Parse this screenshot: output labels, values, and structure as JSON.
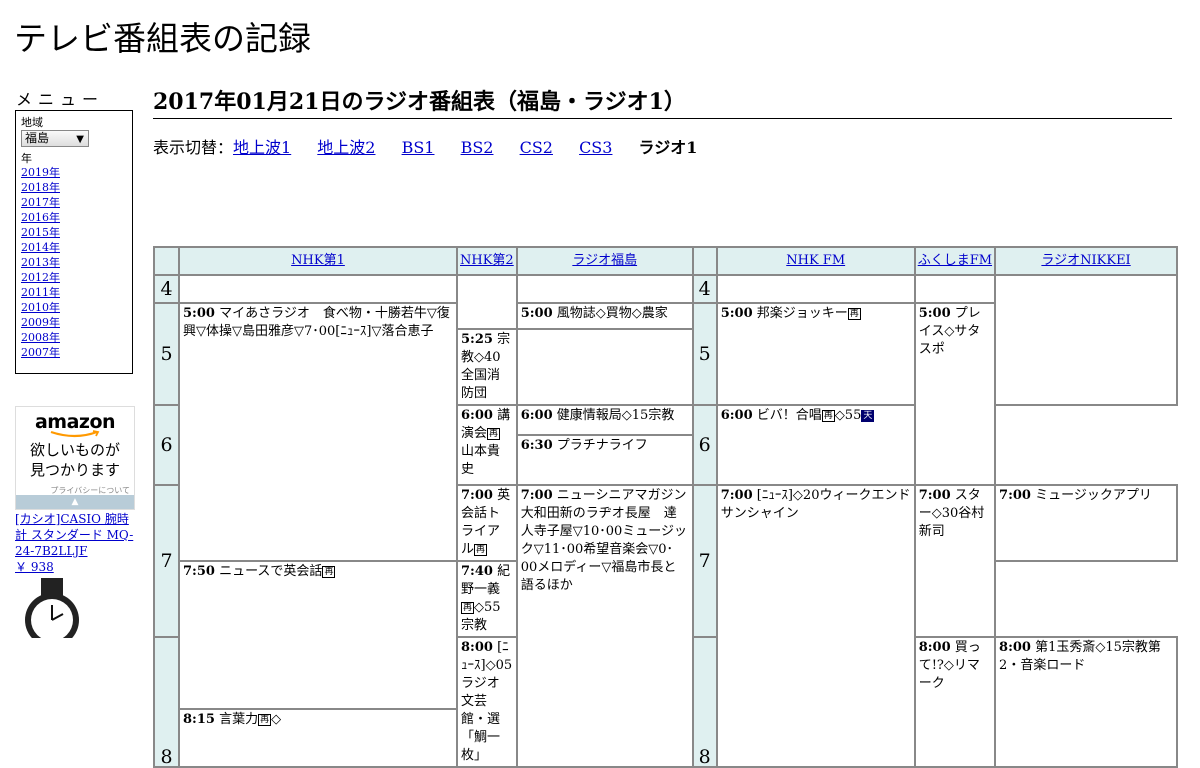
{
  "site": {
    "title": "テレビ番組表の記録"
  },
  "menu": {
    "label": "メニュー",
    "region_label": "地域",
    "region_value": "福島",
    "year_label": "年",
    "years": [
      "2019年",
      "2018年",
      "2017年",
      "2016年",
      "2015年",
      "2014年",
      "2013年",
      "2012年",
      "2011年",
      "2010年",
      "2009年",
      "2008年",
      "2007年"
    ]
  },
  "ad": {
    "logo": "amazon",
    "copy_line1": "欲しいものが",
    "copy_line2": "見つかります",
    "privacy": "プライバシーについて",
    "product": "[カシオ]CASIO 腕時計 スタンダード MQ-24-7B2LLJF",
    "price": "￥ 938"
  },
  "page": {
    "heading": "2017年01月21日のラジオ番組表（福島・ラジオ1）"
  },
  "switcher": {
    "prefix": "表示切替：",
    "links": [
      "地上波1",
      "地上波2",
      "BS1",
      "BS2",
      "CS2",
      "CS3"
    ],
    "current": "ラジオ1"
  },
  "timetable": {
    "channels": [
      "NHK第1",
      "NHK第2",
      "ラジオ福島",
      "NHK FM",
      "ふくしまFM",
      "ラジオNIKKEI"
    ],
    "hours": [
      "4",
      "5",
      "6",
      "7",
      "8"
    ],
    "programs": {
      "nhk1_500": {
        "time": "5:00",
        "title": "マイあさラジオ　食べ物・十勝若牛▽復興▽体操▽島田雅彦▽7･00[ﾆｭｰｽ]▽落合恵子"
      },
      "nhk1_800": {
        "time": "8:00",
        "title": "[ﾆｭｰｽ]◇05ラジオ文芸館・選「鯛一枚」"
      },
      "nhk2_600": {
        "time": "6:00",
        "title": "講演会",
        "icon": "再",
        "extra": "　山本貴史"
      },
      "nhk2_700": {
        "time": "7:00",
        "title": "英会話トライアル",
        "icon": "再"
      },
      "nhk2_750": {
        "time": "7:50",
        "title": "ニュースで英会話",
        "icon": "再"
      },
      "nhk2_815": {
        "time": "8:15",
        "title": "言葉力",
        "icon": "再",
        "extra": "◇"
      },
      "rfc_500": {
        "time": "5:00",
        "title": "風物誌◇買物◇農家"
      },
      "rfc_525": {
        "time": "5:25",
        "title": "宗教◇40全国消防団"
      },
      "rfc_600": {
        "time": "6:00",
        "title": "健康情報局◇15宗教"
      },
      "rfc_630": {
        "time": "6:30",
        "title": "プラチナライフ"
      },
      "rfc_700": {
        "time": "7:00",
        "title": "ニューシニアマガジン　大和田新のラヂオ長屋　達人寺子屋▽10･00ミュージック▽11･00希望音楽会▽0･00メロディー▽福島市長と語るほか"
      },
      "fm_500": {
        "time": "5:00",
        "title": "邦楽ジョッキー",
        "icon": "再"
      },
      "fm_600": {
        "time": "6:00",
        "title": "ビバ！合唱",
        "icon": "再",
        "extra": "◇55",
        "icon2": "天"
      },
      "fm_700": {
        "time": "7:00",
        "title": "[ﾆｭｰｽ]◇20ウィークエンドサンシャイン"
      },
      "ffm_500": {
        "time": "5:00",
        "title": "プレイス◇サタスポ"
      },
      "ffm_700": {
        "time": "7:00",
        "title": "スター◇30谷村新司"
      },
      "ffm_800": {
        "time": "8:00",
        "title": "買って!?◇リマーク"
      },
      "nikkei_700": {
        "time": "7:00",
        "title": "ミュージックアプリ"
      },
      "nikkei_740": {
        "time": "7:40",
        "title": "紀野一義",
        "icon": "再",
        "extra": "◇55宗教"
      },
      "nikkei_800": {
        "time": "8:00",
        "title": "第1玉秀斎◇15宗教第2・音楽ロード"
      }
    }
  }
}
